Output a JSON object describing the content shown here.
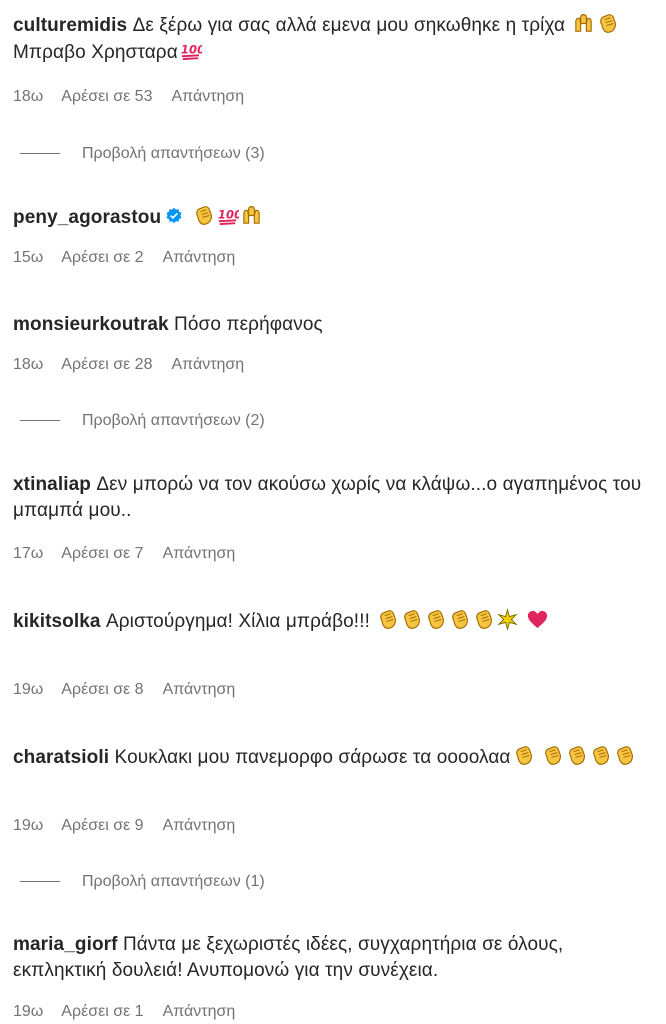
{
  "comments": [
    {
      "username": "culturemidis",
      "text_a": "Δε ξέρω για σας αλλά εμενα μου σηκωθηκε η τρίχα",
      "text_b": "Μπραβο Χρησταρα",
      "time": "18ω",
      "likes": "Αρέσει σε 53",
      "reply": "Απάντηση"
    },
    {
      "username": "peny_agorastou",
      "time": "15ω",
      "likes": "Αρέσει σε 2",
      "reply": "Απάντηση"
    },
    {
      "username": "monsieurkoutrak",
      "text": "Πόσο περήφανος",
      "time": "18ω",
      "likes": "Αρέσει σε 28",
      "reply": "Απάντηση"
    },
    {
      "username": "xtinaliap",
      "text": "Δεν μπορώ να τον ακούσω χωρίς να κλάψω...ο αγαπημένος του μπαμπά μου..",
      "time": "17ω",
      "likes": "Αρέσει σε 7",
      "reply": "Απάντηση"
    },
    {
      "username": "kikitsolka",
      "text": "Αριστούργημα! Χίλια μπράβο!!!",
      "time": "19ω",
      "likes": "Αρέσει σε 8",
      "reply": "Απάντηση"
    },
    {
      "username": "charatsioli",
      "text": "Κουκλακι μου πανεμορφο σάρωσε τα οοοολαα",
      "time": "19ω",
      "likes": "Αρέσει σε 9",
      "reply": "Απάντηση"
    },
    {
      "username": "maria_giorf",
      "text": "Πάντα με ξεχωριστές ιδέες, συγχαρητήρια σε όλους, εκπληκτική δουλειά! Ανυπομονώ για την συνέχεια.",
      "time": "19ω",
      "likes": "Αρέσει σε 1",
      "reply": "Απάντηση"
    }
  ],
  "view_replies": [
    "Προβολή απαντήσεων (3)",
    "Προβολή απαντήσεων (2)",
    "Προβολή απαντήσεων (1)"
  ],
  "colors": {
    "text": "#262626",
    "muted": "#737373",
    "verified": "#0095f6",
    "clap": "#f5c542",
    "hundred": "#e0245e",
    "heart": "#e0245e"
  }
}
